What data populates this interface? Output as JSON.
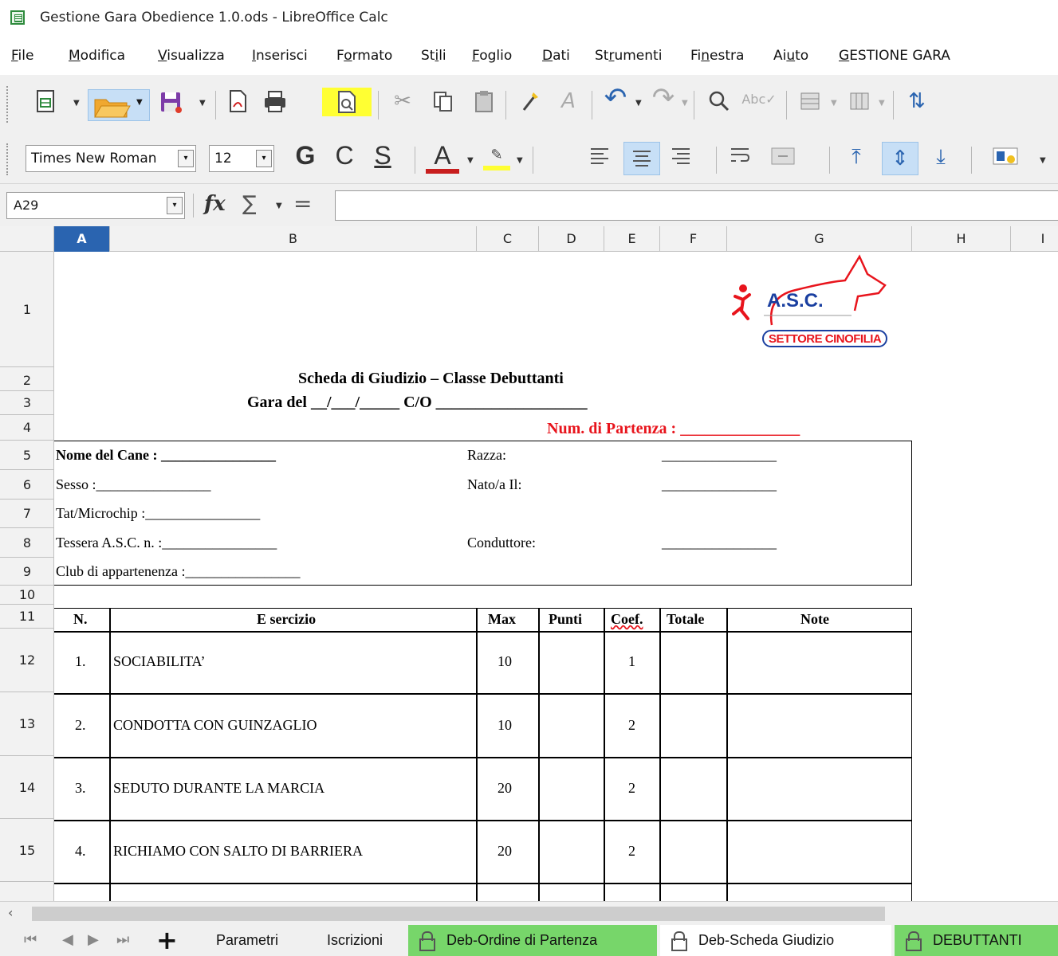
{
  "window": {
    "title": "Gestione Gara Obedience 1.0.ods - LibreOffice Calc"
  },
  "menu": [
    {
      "label": "File",
      "ul": "F",
      "rest": "ile"
    },
    {
      "label": "Modifica",
      "ul": "M",
      "rest": "odifica"
    },
    {
      "label": "Visualizza",
      "ul": "V",
      "rest": "isualizza"
    },
    {
      "label": "Inserisci",
      "ul": "I",
      "rest": "nserisci"
    },
    {
      "label": "Formato",
      "pre": "F",
      "ul": "o",
      "rest": "rmato"
    },
    {
      "label": "Stili",
      "pre": "St",
      "ul": "i",
      "rest": "li"
    },
    {
      "label": "Foglio",
      "ul": "F",
      "rest": "oglio"
    },
    {
      "label": "Dati",
      "ul": "D",
      "rest": "ati"
    },
    {
      "label": "Strumenti",
      "pre": "St",
      "ul": "r",
      "rest": "umenti"
    },
    {
      "label": "Finestra",
      "pre": "Fi",
      "ul": "n",
      "rest": "estra"
    },
    {
      "label": "Aiuto",
      "pre": "Ai",
      "ul": "u",
      "rest": "to"
    },
    {
      "label": "GESTIONE GARA",
      "ul": "G",
      "rest": "ESTIONE GARA"
    }
  ],
  "format_toolbar": {
    "font_name": "Times New Roman",
    "font_size": "12",
    "bold": "G",
    "italic": "C",
    "underline": "S",
    "font_color_glyph": "A"
  },
  "formula_bar": {
    "cell_ref": "A29",
    "fx": "fx",
    "sum": "∑",
    "equals": "="
  },
  "columns": [
    "A",
    "B",
    "C",
    "D",
    "E",
    "F",
    "G",
    "H",
    "I"
  ],
  "active_column": "A",
  "rows": [
    "1",
    "2",
    "3",
    "4",
    "5",
    "6",
    "7",
    "8",
    "9",
    "10",
    "11",
    "12",
    "13",
    "14",
    "15"
  ],
  "logo": {
    "text": "A.S.C.",
    "subtitle": "SETTORE CINOFILIA"
  },
  "sheet": {
    "title": "Scheda di Giudizio – Classe Debuttanti",
    "gara": "Gara del __/___/_____ C/O ___________________",
    "partenza_label": "Num. di Partenza : ",
    "partenza_blank": "_______________",
    "nome_cane": "Nome del Cane : ________________",
    "sesso": "Sesso :________________",
    "tat": "Tat/Microchip :________________",
    "tessera": "Tessera A.S.C. n. :________________",
    "club": "Club di appartenenza :________________",
    "razza": "Razza:",
    "nato": "Nato/a Il:",
    "conduttore": "Conduttore:",
    "blank_right": "________________",
    "table_headers": {
      "n": "N.",
      "esercizio": "E sercizio",
      "max": "Max",
      "punti": "Punti",
      "coef": "Coef.",
      "totale": "Totale",
      "note": "Note"
    },
    "exercises": [
      {
        "n": "1.",
        "name": "SOCIABILITA’",
        "max": "10",
        "coef": "1"
      },
      {
        "n": "2.",
        "name": "CONDOTTA CON GUINZAGLIO",
        "max": "10",
        "coef": "2"
      },
      {
        "n": "3.",
        "name": "SEDUTO DURANTE LA MARCIA",
        "max": "20",
        "coef": "2"
      },
      {
        "n": "4.",
        "name": "RICHIAMO CON SALTO DI BARRIERA",
        "max": "20",
        "coef": "2"
      }
    ]
  },
  "sheet_tabs": [
    {
      "label": "Parametri",
      "style": "plain"
    },
    {
      "label": "Iscrizioni",
      "style": "plain"
    },
    {
      "label": "Deb-Ordine di Partenza",
      "style": "green"
    },
    {
      "label": "Deb-Scheda Giudizio",
      "style": "active"
    },
    {
      "label": "DEBUTTANTI",
      "style": "green"
    }
  ],
  "colors": {
    "accent": "#2a64b0",
    "highlight": "#ffff33",
    "tab_green": "#77d66a",
    "red_title": "#e8141c"
  }
}
